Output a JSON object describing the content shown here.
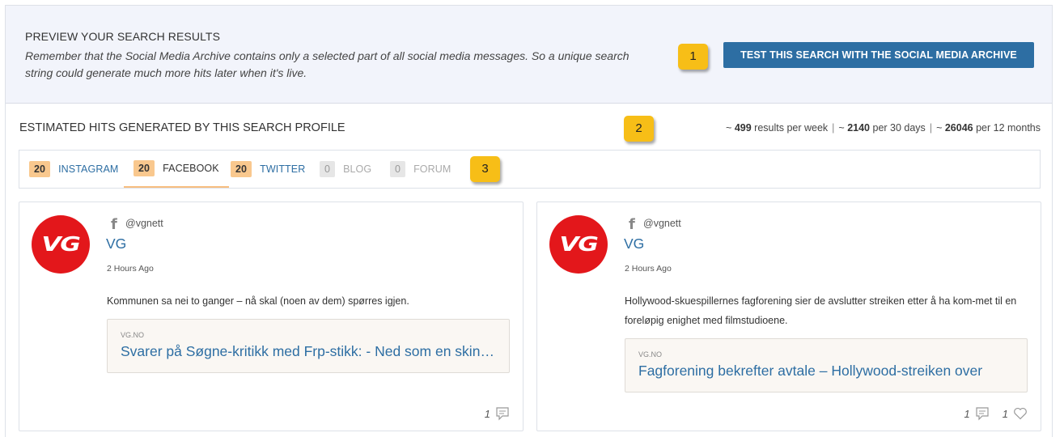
{
  "preview": {
    "title": "PREVIEW YOUR SEARCH RESULTS",
    "text": "Remember that the Social Media Archive contains only a selected part of all social media messages. So a unique search string could generate much more hits later when it's live.",
    "button_label": "TEST THIS SEARCH WITH THE SOCIAL MEDIA ARCHIVE"
  },
  "markers": [
    "1",
    "2",
    "3"
  ],
  "hits": {
    "title": "ESTIMATED HITS GENERATED BY THIS SEARCH PROFILE",
    "prefix1": "~ ",
    "week": "499",
    "week_label": " results per week",
    "prefix2": "~ ",
    "days": "2140",
    "days_label": " per 30 days",
    "prefix3": "~ ",
    "months": "26046",
    "months_label": " per 12 months",
    "sep": "|"
  },
  "tabs": [
    {
      "count": "20",
      "label": "INSTAGRAM"
    },
    {
      "count": "20",
      "label": "FACEBOOK"
    },
    {
      "count": "20",
      "label": "TWITTER"
    },
    {
      "count": "0",
      "label": "BLOG"
    },
    {
      "count": "0",
      "label": "FORUM"
    }
  ],
  "posts": [
    {
      "logo_text": "VG",
      "network_icon": "f",
      "handle": "@vgnett",
      "source": "VG",
      "time": "2 Hours Ago",
      "message": "Kommunen sa nei to ganger – nå skal (noen av dem) spørres igjen.",
      "link_domain": "VG.NO",
      "link_title": "Svarer på Søgne-kritikk med Frp-stikk: - Ned som en skinnende stjerne",
      "comments": "1"
    },
    {
      "logo_text": "VG",
      "network_icon": "f",
      "handle": "@vgnett",
      "source": "VG",
      "time": "2 Hours Ago",
      "message": "Hollywood-skuespillernes fagforening sier de avslutter streiken etter å ha kom-met til en foreløpig enighet med filmstudioene.",
      "link_domain": "VG.NO",
      "link_title": "Fagforening bekrefter avtale – Hollywood-streiken over",
      "comments": "1",
      "likes": "1"
    }
  ]
}
